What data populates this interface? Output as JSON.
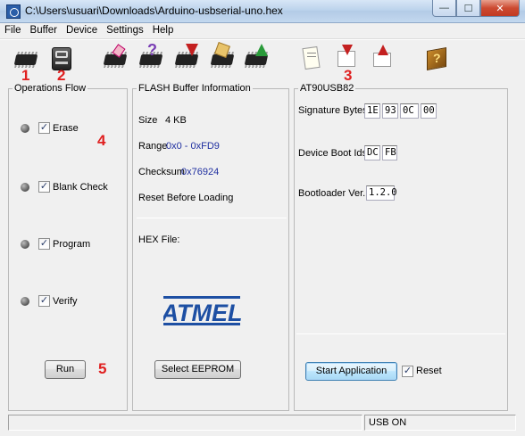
{
  "window": {
    "title": "C:\\Users\\usuari\\Downloads\\Arduino-usbserial-uno.hex",
    "minimize": "—",
    "maximize": "☐",
    "close": "✕"
  },
  "menu": [
    "File",
    "Buffer",
    "Device",
    "Settings",
    "Help"
  ],
  "toolbar": {
    "tools": [
      "select-device-icon",
      "communication-icon",
      "erase-icon",
      "blank-check-icon",
      "program-icon",
      "verify-icon",
      "read-icon",
      "load-hex-icon",
      "save-hex-icon",
      "edit-buffer-icon",
      "help-icon"
    ],
    "annotations": [
      "1",
      "2",
      "3",
      "4",
      "5"
    ]
  },
  "operations": {
    "legend": "Operations Flow",
    "items": [
      {
        "label": "Erase",
        "checked": "✓"
      },
      {
        "label": "Blank Check",
        "checked": "✓"
      },
      {
        "label": "Program",
        "checked": "✓"
      },
      {
        "label": "Verify",
        "checked": "✓"
      }
    ],
    "run_label": "Run"
  },
  "flash": {
    "legend": "FLASH Buffer Information",
    "size_label": "Size",
    "size_value": "4 KB",
    "range_label": "Range",
    "range_value": "0x0 - 0xFD9",
    "checksum_label": "Checksum",
    "checksum_value": "0x76924",
    "reset_label": "Reset Before Loading",
    "hex_label": "HEX File:",
    "logo_text": "ATMEL",
    "eeprom_button": "Select EEPROM"
  },
  "device": {
    "legend": "AT90USB82",
    "signature_label": "Signature Bytes",
    "signature": [
      "1E",
      "93",
      "0C",
      "00"
    ],
    "boot_ids_label": "Device Boot Ids",
    "boot_ids": [
      "DC",
      "FB"
    ],
    "bootloader_label": "Bootloader Ver.",
    "bootloader_value": "1.2.0",
    "start_app_button": "Start Application",
    "reset_label": "Reset",
    "reset_checked": "✓"
  },
  "status": {
    "left": "",
    "right": "USB ON"
  },
  "colors": {
    "value_blue": "#1f2fa0",
    "annotation_red": "#e02020",
    "atmel_blue": "#1d4fa3"
  }
}
